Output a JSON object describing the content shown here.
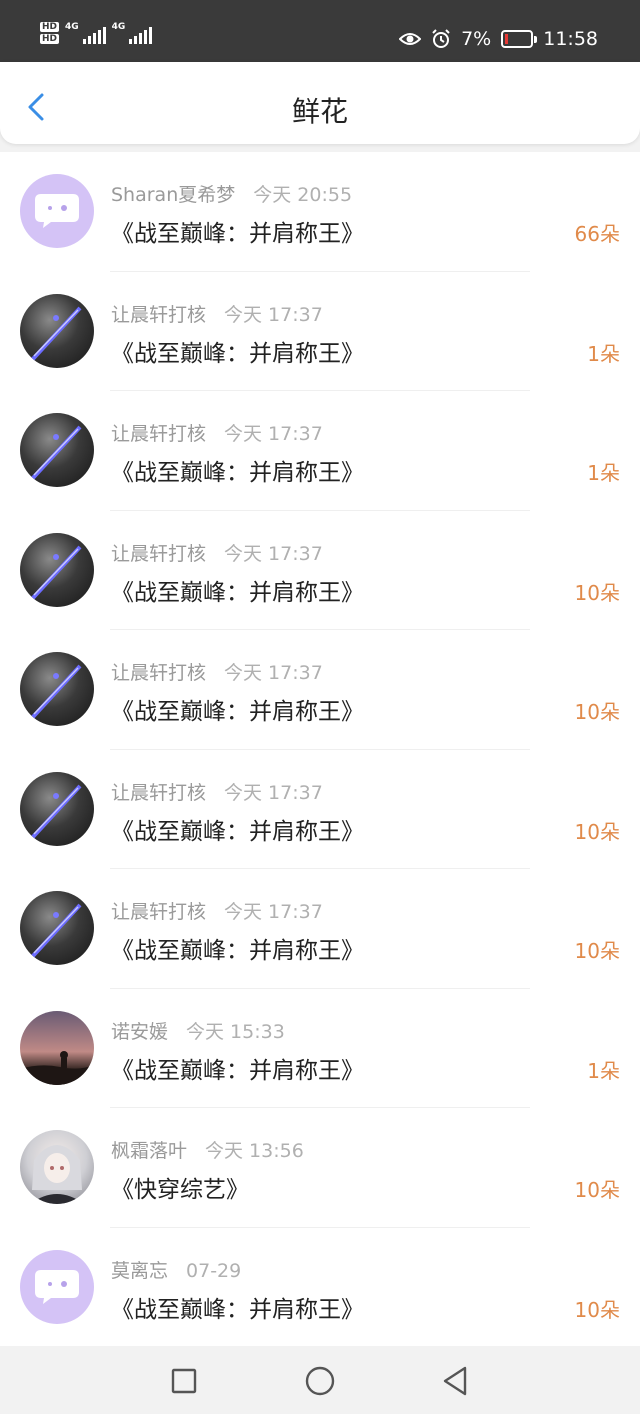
{
  "status_bar": {
    "sim1": "HD",
    "sim2": "HD",
    "network1": "4G",
    "network2": "4G",
    "battery_percent": "7%",
    "time": "11:58"
  },
  "header": {
    "title": "鲜花",
    "back_icon": "chevron-left-icon"
  },
  "colors": {
    "accent_blue": "#3a8ee6",
    "flower_count": "#e08a4a"
  },
  "items": [
    {
      "name": "Sharan夏希梦",
      "time": "今天 20:55",
      "book": "《战至巅峰：并肩称王》",
      "count": "66朵",
      "avatar": "chat-bubble-avatar"
    },
    {
      "name": "让晨轩打核",
      "time": "今天 17:37",
      "book": "《战至巅峰：并肩称王》",
      "count": "1朵",
      "avatar": "knight-avatar"
    },
    {
      "name": "让晨轩打核",
      "time": "今天 17:37",
      "book": "《战至巅峰：并肩称王》",
      "count": "1朵",
      "avatar": "knight-avatar"
    },
    {
      "name": "让晨轩打核",
      "time": "今天 17:37",
      "book": "《战至巅峰：并肩称王》",
      "count": "10朵",
      "avatar": "knight-avatar"
    },
    {
      "name": "让晨轩打核",
      "time": "今天 17:37",
      "book": "《战至巅峰：并肩称王》",
      "count": "10朵",
      "avatar": "knight-avatar"
    },
    {
      "name": "让晨轩打核",
      "time": "今天 17:37",
      "book": "《战至巅峰：并肩称王》",
      "count": "10朵",
      "avatar": "knight-avatar"
    },
    {
      "name": "让晨轩打核",
      "time": "今天 17:37",
      "book": "《战至巅峰：并肩称王》",
      "count": "10朵",
      "avatar": "knight-avatar"
    },
    {
      "name": "诺安媛",
      "time": "今天 15:33",
      "book": "《战至巅峰：并肩称王》",
      "count": "1朵",
      "avatar": "sunset-silhouette-avatar"
    },
    {
      "name": "枫霜落叶",
      "time": "今天 13:56",
      "book": "《快穿综艺》",
      "count": "10朵",
      "avatar": "anime-girl-avatar"
    },
    {
      "name": "莫离忘",
      "time": "07-29",
      "book": "《战至巅峰：并肩称王》",
      "count": "10朵",
      "avatar": "chat-bubble-avatar"
    }
  ],
  "nav_bar": {
    "recents_icon": "square-icon",
    "home_icon": "circle-icon",
    "back_icon": "triangle-back-icon"
  }
}
